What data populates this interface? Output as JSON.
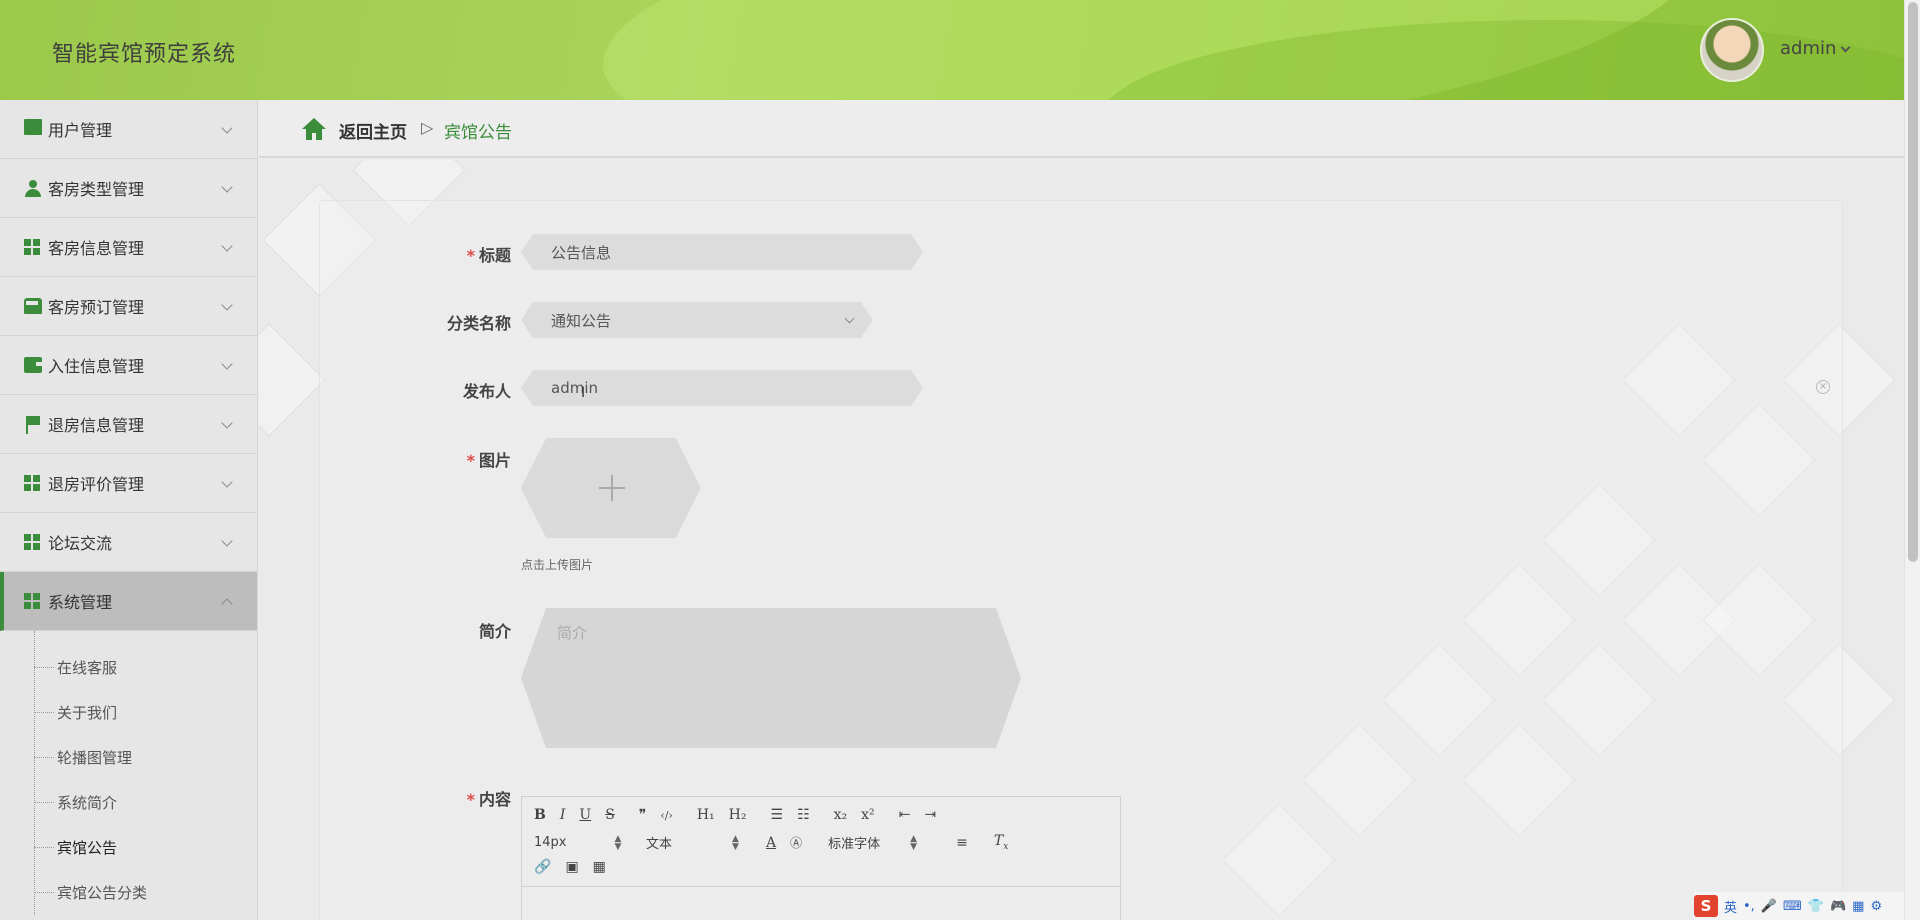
{
  "header": {
    "app_title": "智能宾馆预定系统",
    "user_name": "admin"
  },
  "sidebar": {
    "items": [
      {
        "label": "用户管理",
        "icon": "monitor-icon"
      },
      {
        "label": "客房类型管理",
        "icon": "user-icon"
      },
      {
        "label": "客房信息管理",
        "icon": "grid-icon"
      },
      {
        "label": "客房预订管理",
        "icon": "bus-icon"
      },
      {
        "label": "入住信息管理",
        "icon": "wallet-icon"
      },
      {
        "label": "退房信息管理",
        "icon": "flag-icon"
      },
      {
        "label": "退房评价管理",
        "icon": "grid-icon"
      },
      {
        "label": "论坛交流",
        "icon": "grid-icon"
      },
      {
        "label": "系统管理",
        "icon": "grid-icon",
        "expanded": true
      }
    ],
    "sub_items": [
      {
        "label": "在线客服"
      },
      {
        "label": "关于我们"
      },
      {
        "label": "轮播图管理"
      },
      {
        "label": "系统简介"
      },
      {
        "label": "宾馆公告",
        "current": true
      },
      {
        "label": "宾馆公告分类"
      }
    ]
  },
  "breadcrumb": {
    "home": "返回主页",
    "separator": "▷",
    "current": "宾馆公告"
  },
  "form": {
    "title_label": "标题",
    "title_value": "公告信息",
    "category_label": "分类名称",
    "category_value": "通知公告",
    "publisher_label": "发布人",
    "publisher_value": "admin",
    "image_label": "图片",
    "image_hint": "点击上传图片",
    "intro_label": "简介",
    "intro_placeholder": "简介",
    "content_label": "内容",
    "required_mark": "*"
  },
  "editor": {
    "row1": [
      "B",
      "I",
      "U",
      "S",
      "❞",
      "‹/›",
      "H₁",
      "H₂",
      "☰",
      "☷",
      "x₂",
      "x²",
      "⇤",
      "⇥"
    ],
    "font_size": "14px",
    "text_type": "文本",
    "font_family": "标准字体",
    "row3": [
      "🔗",
      "▣",
      "▦"
    ]
  },
  "ime": {
    "logo": "S",
    "lang": "英"
  },
  "colors": {
    "accent": "#3b8d3b",
    "header_green": "#9bc94a",
    "required": "#e04b4b"
  }
}
